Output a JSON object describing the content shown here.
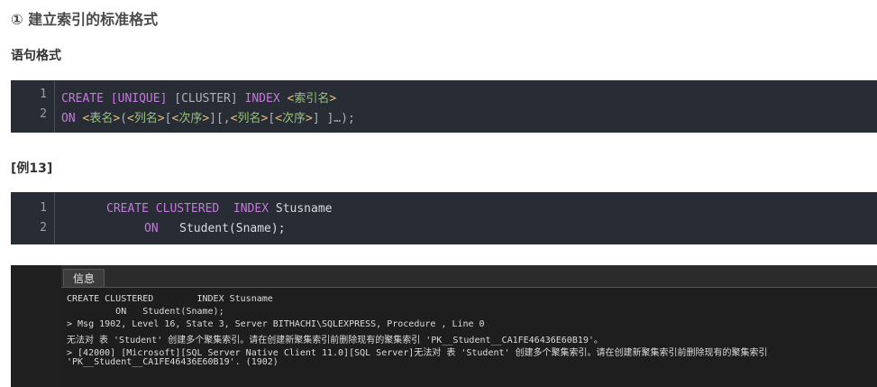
{
  "heading": "① 建立索引的标准格式",
  "syntax_label": "语句格式",
  "syntax_block": {
    "line_numbers": [
      "1",
      "2"
    ],
    "line1": {
      "create": "CREATE",
      "unique": "[UNIQUE]",
      "clustered": "[CLUSTER]",
      "index": "INDEX",
      "lt": "<",
      "index_name": "索引名",
      "gt": ">"
    },
    "line2": {
      "on": "ON",
      "lt1": "<",
      "table_name": "表名",
      "gt1": ">",
      "open": "(",
      "lt2": "<",
      "col1": "列名",
      "gt2": ">",
      "br1": "[",
      "lt3": "<",
      "ord1": "次序",
      "gt3": ">",
      "br2": "][,",
      "lt4": "<",
      "col2": "列名",
      "gt4": ">",
      "br3": "[",
      "lt5": "<",
      "ord2": "次序",
      "gt5": ">",
      "tail": "] ]…);"
    }
  },
  "example_label": "[例13]",
  "example_block": {
    "line_numbers": [
      "1",
      "2"
    ],
    "create": "CREATE",
    "clustered": "CLUSTERED",
    "index": "INDEX",
    "index_name": "Stusname",
    "on": "ON",
    "target": "Student(Sname);"
  },
  "result_panel": {
    "tab_label": "信息",
    "lines": [
      "CREATE CLUSTERED        INDEX Stusname",
      "         ON   Student(Sname);",
      "> Msg 1902, Level 16, State 3, Server BITHACHI\\SQLEXPRESS, Procedure , Line 0",
      "无法对 表 'Student' 创建多个聚集索引。请在创建新聚集索引前删除现有的聚集索引 'PK__Student__CA1FE46436E60B19'。",
      "> [42000] [Microsoft][SQL Server Native Client 11.0][SQL Server]无法对 表 'Student' 创建多个聚集索引。请在创建新聚集索引前删除现有的聚集索引",
      "'PK__Student__CA1FE46436E60B19'. (1902)"
    ]
  },
  "colors": {
    "code_bg": "#282c34",
    "keyword": "#c678dd",
    "angle": "#e5c07b",
    "name": "#98c379"
  }
}
